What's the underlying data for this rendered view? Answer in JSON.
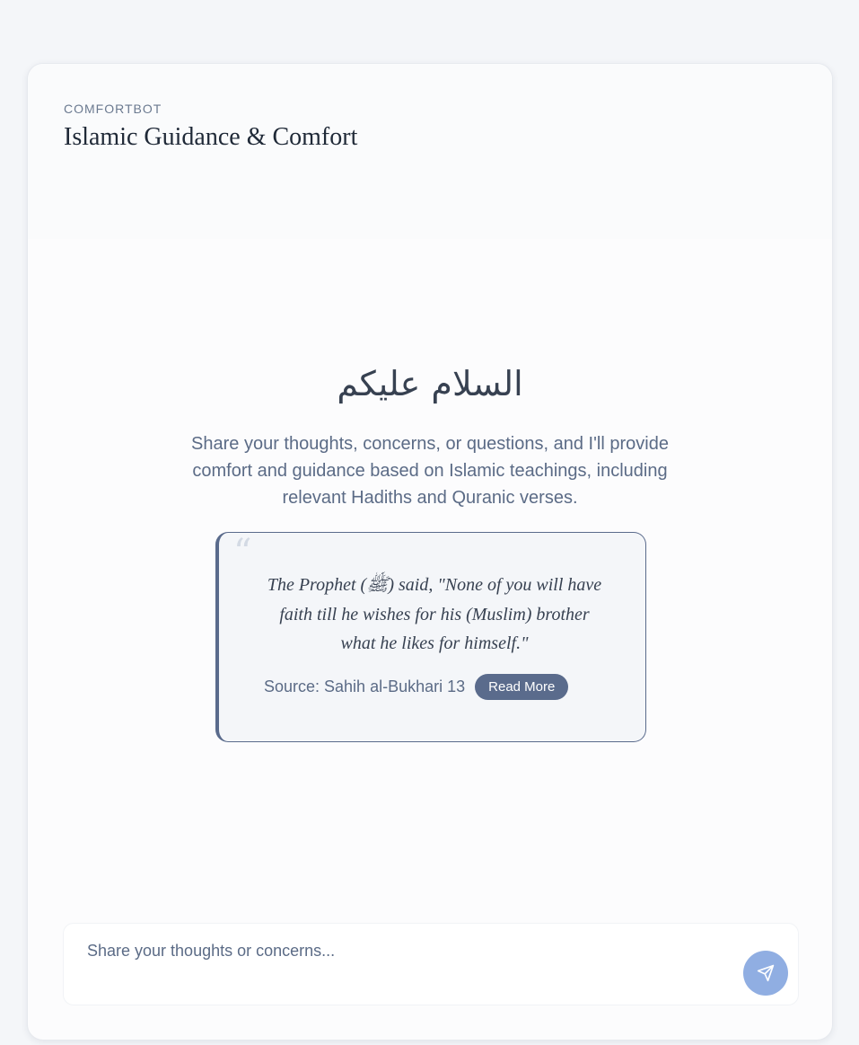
{
  "header": {
    "brand": "COMFORTBOT",
    "title": "Islamic Guidance & Comfort"
  },
  "welcome": {
    "greeting": "السلام عليكم",
    "intro": "Share your thoughts, concerns, or questions, and I'll provide comfort and guidance based on Islamic teachings, including relevant Hadiths and Quranic verses."
  },
  "hadith": {
    "quote_icon": "quote-icon",
    "text": "The Prophet (ﷺ) said, \"None of you will have faith till he wishes for his (Muslim) brother what he likes for himself.\"",
    "source": "Source: Sahih al-Bukhari 13",
    "read_more_label": "Read More"
  },
  "composer": {
    "placeholder": "Share your thoughts or concerns...",
    "value": "",
    "send_icon": "send-icon"
  },
  "colors": {
    "accent": "#5a6b8c",
    "send_button": "#90aee2",
    "text_muted": "#5b6b86"
  }
}
